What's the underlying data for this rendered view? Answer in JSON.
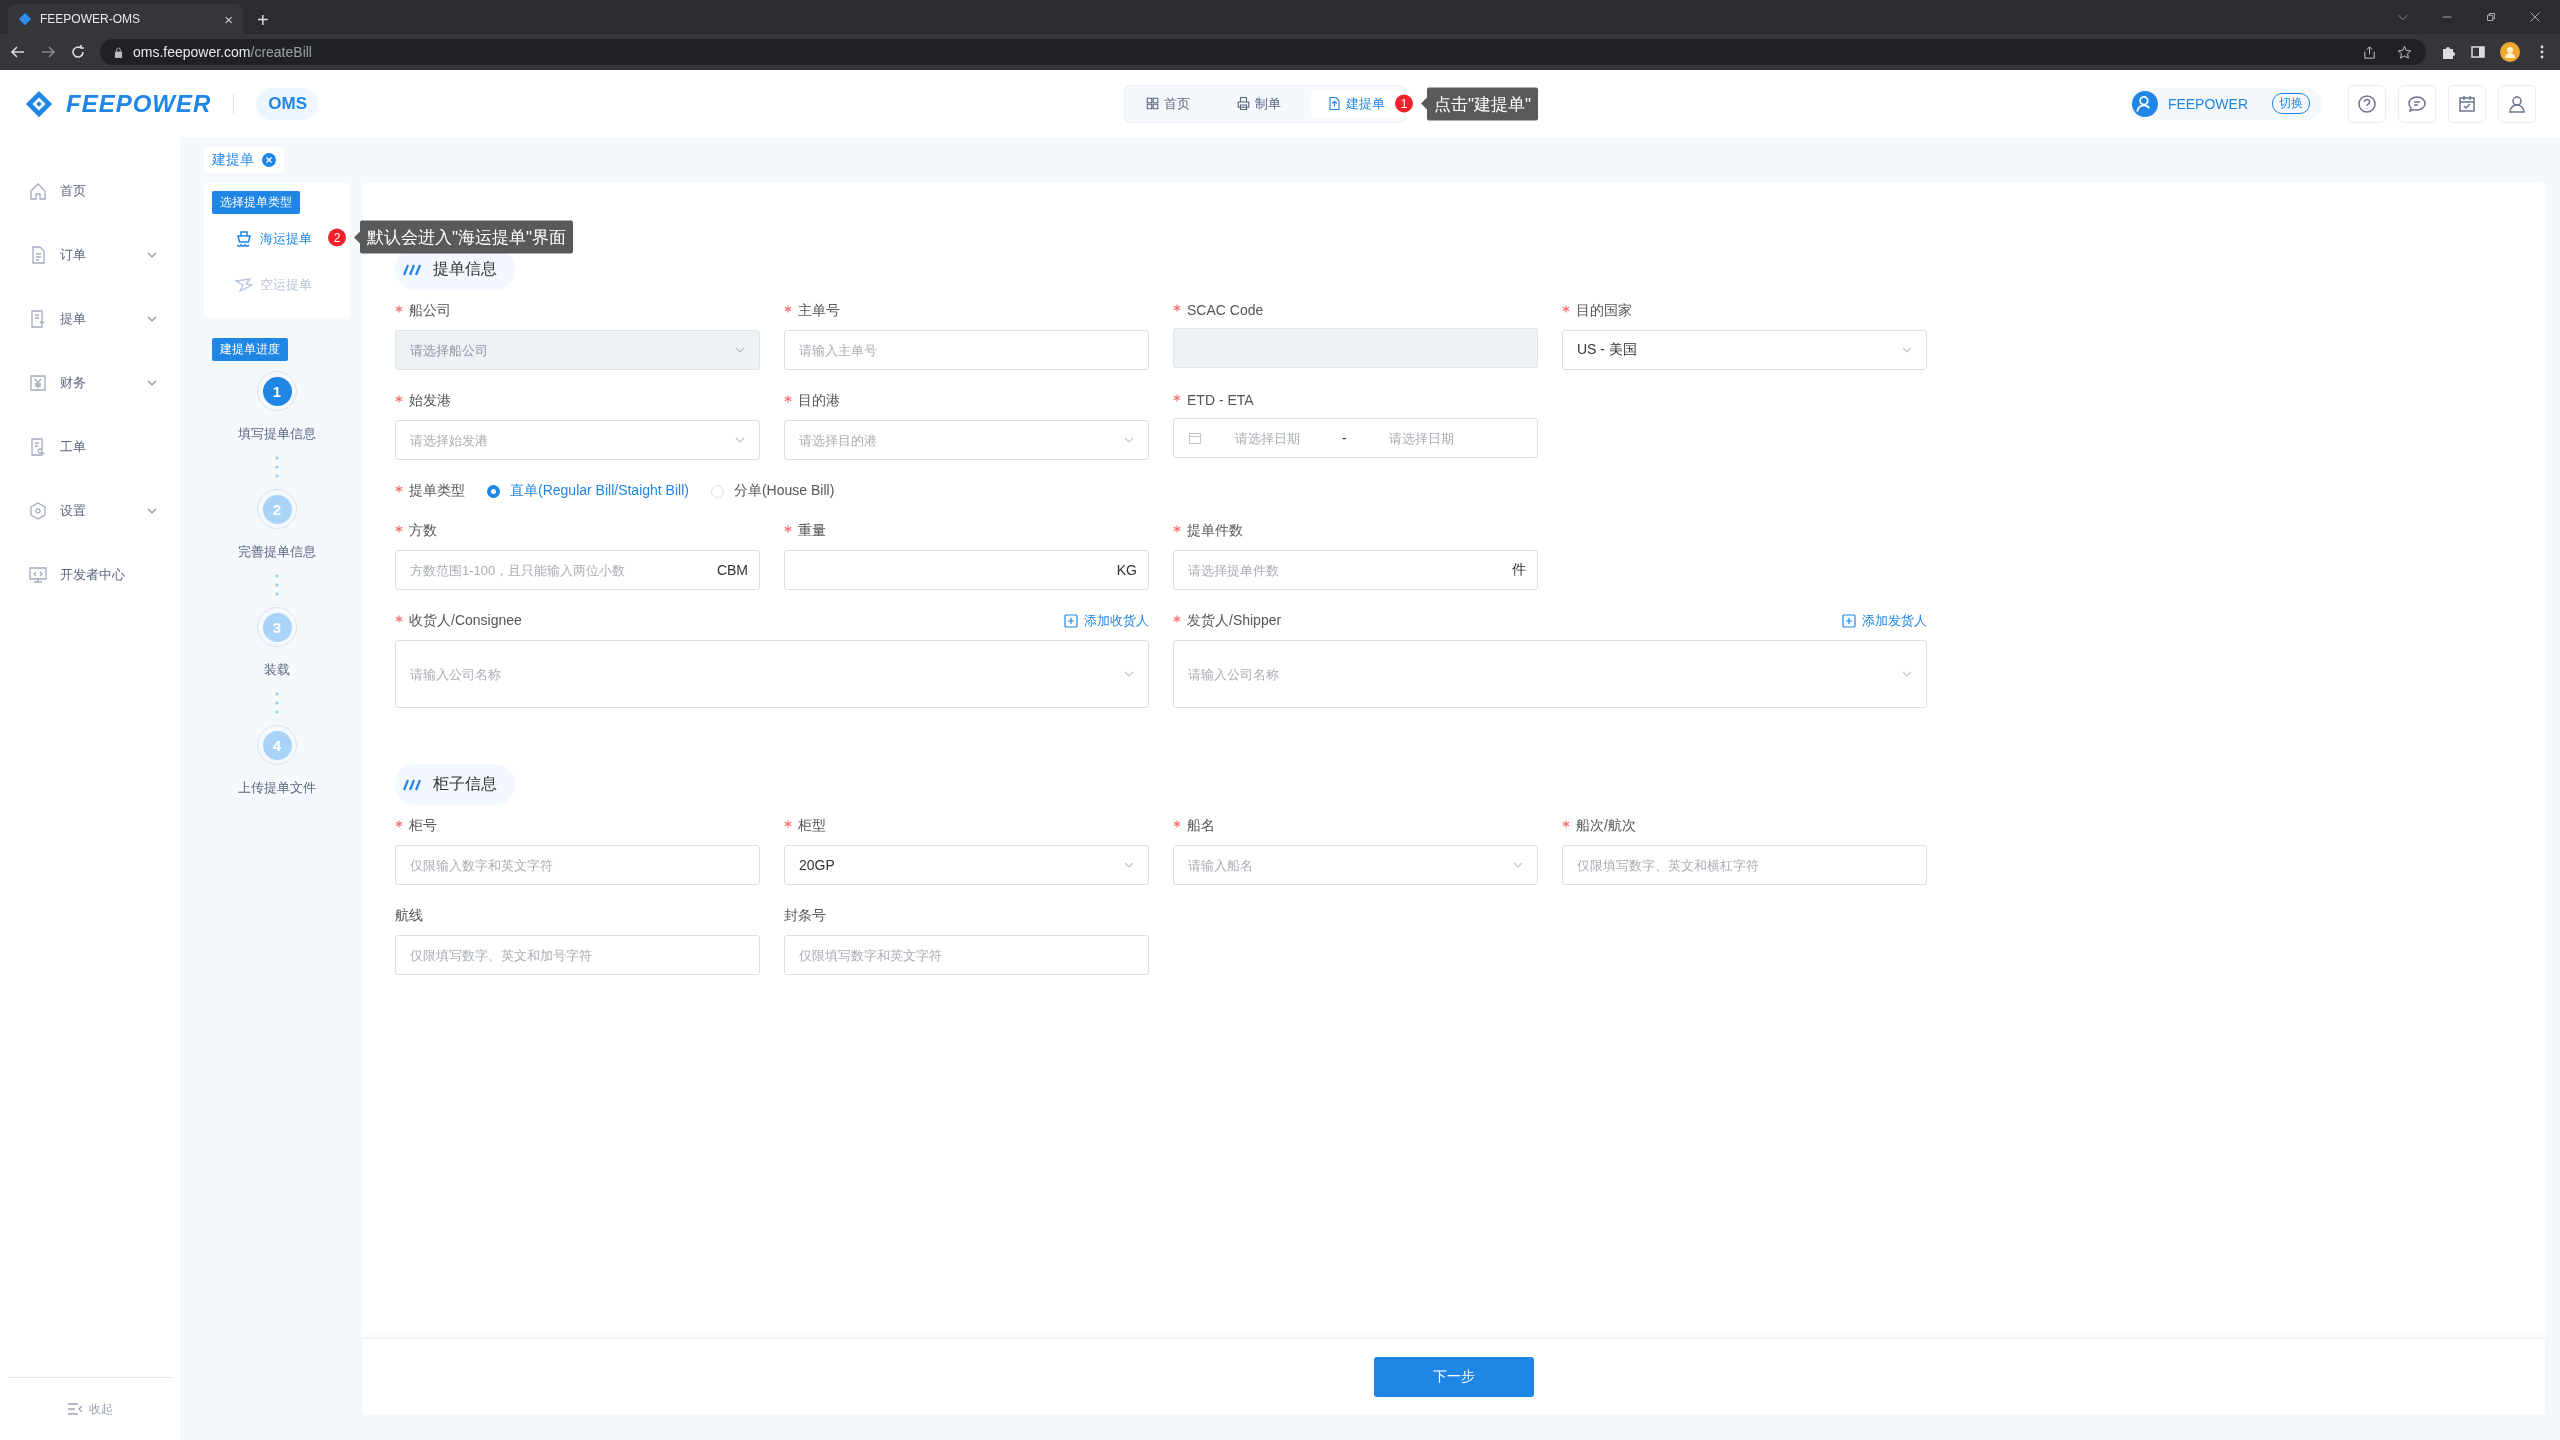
{
  "browser": {
    "tab_title": "FEEPOWER-OMS",
    "tab_close": "×",
    "new_tab": "+",
    "url_host": "oms.feepower.com",
    "url_path": "/createBill"
  },
  "header": {
    "logo": "FEEPOWER",
    "app": "OMS",
    "nav": [
      {
        "label": "首页",
        "selected": false
      },
      {
        "label": "制单",
        "selected": false
      },
      {
        "label": "建提单",
        "selected": true,
        "badge": "1"
      }
    ],
    "nav_tooltip": "点击\"建提单\"",
    "user": "FEEPOWER",
    "switch": "切换"
  },
  "sidebar": {
    "items": [
      {
        "label": "首页",
        "has_submenu": false
      },
      {
        "label": "订单",
        "has_submenu": true
      },
      {
        "label": "提单",
        "has_submenu": true
      },
      {
        "label": "财务",
        "has_submenu": true
      },
      {
        "label": "工单",
        "has_submenu": false
      },
      {
        "label": "设置",
        "has_submenu": true
      },
      {
        "label": "开发者中心",
        "has_submenu": false
      }
    ],
    "collapse": "收起"
  },
  "page_tabs": [
    {
      "label": "建提单",
      "selected": true
    }
  ],
  "bill_type": {
    "title": "选择提单类型",
    "tooltip": "默认会进入\"海运提单\"界面",
    "options": [
      {
        "label": "海运提单",
        "selected": true,
        "badge": "2"
      },
      {
        "label": "空运提单",
        "selected": false
      }
    ]
  },
  "progress": {
    "title": "建提单进度",
    "steps": [
      {
        "number": "1",
        "label": "填写提单信息",
        "selected": true
      },
      {
        "number": "2",
        "label": "完善提单信息",
        "selected": false
      },
      {
        "number": "3",
        "label": "装载",
        "selected": false
      },
      {
        "number": "4",
        "label": "上传提单文件",
        "selected": false
      }
    ]
  },
  "sections": [
    {
      "title": "提单信息",
      "rows": [
        [
          {
            "kind": "select",
            "label": "船公司",
            "required": true,
            "placeholder": "请选择船公司",
            "disabled": true
          },
          {
            "kind": "input",
            "label": "主单号",
            "required": true,
            "placeholder": "请输入主单号",
            "disabled": false
          },
          {
            "kind": "input",
            "label": "SCAC Code",
            "required": true,
            "disabled": true
          },
          {
            "kind": "select",
            "label": "目的国家",
            "required": true,
            "value": "US - 美国",
            "disabled": false
          }
        ],
        [
          {
            "kind": "select",
            "label": "始发港",
            "required": true,
            "placeholder": "请选择始发港",
            "disabled": false
          },
          {
            "kind": "select",
            "label": "目的港",
            "required": true,
            "placeholder": "请选择目的港",
            "disabled": false
          },
          {
            "kind": "daterange",
            "label": "ETD - ETA",
            "required": true,
            "start_placeholder": "请选择日期",
            "separator": "-",
            "end_placeholder": "请选择日期",
            "disabled": false
          }
        ],
        [
          {
            "kind": "radio",
            "label": "提单类型",
            "required": true,
            "options": [
              {
                "label": "直单(Regular Bill/Staight Bill)",
                "selected": true
              },
              {
                "label": "分单(House Bill)",
                "selected": false
              }
            ]
          }
        ],
        [
          {
            "kind": "input",
            "label": "方数",
            "required": true,
            "placeholder": "方数范围1-100，且只能输入两位小数",
            "suffix": "CBM",
            "disabled": false
          },
          {
            "kind": "input",
            "label": "重量",
            "required": true,
            "suffix": "KG",
            "disabled": false
          },
          {
            "kind": "input",
            "label": "提单件数",
            "required": true,
            "placeholder": "请选择提单件数",
            "suffix": "件",
            "disabled": false
          }
        ]
      ],
      "parties": [
        {
          "kind": "company",
          "label": "收货人/Consignee",
          "required": true,
          "placeholder": "请输入公司名称",
          "action": "添加收货人",
          "disabled": false
        },
        {
          "kind": "company",
          "label": "发货人/Shipper",
          "required": true,
          "placeholder": "请输入公司名称",
          "action": "添加发货人",
          "disabled": false
        }
      ]
    },
    {
      "title": "柜子信息",
      "rows": [
        [
          {
            "kind": "input",
            "label": "柜号",
            "required": true,
            "placeholder": "仅限输入数字和英文字符",
            "disabled": false
          },
          {
            "kind": "select",
            "label": "柜型",
            "required": true,
            "value": "20GP",
            "disabled": false
          },
          {
            "kind": "select",
            "label": "船名",
            "required": true,
            "placeholder": "请输入船名",
            "disabled": false
          },
          {
            "kind": "input",
            "label": "船次/航次",
            "required": true,
            "placeholder": "仅限填写数字、英文和横杠字符",
            "disabled": false
          }
        ],
        [
          {
            "kind": "input",
            "label": "航线",
            "required": false,
            "placeholder": "仅限填写数字、英文和加号字符",
            "disabled": false
          },
          {
            "kind": "input",
            "label": "封条号",
            "required": false,
            "placeholder": "仅限填写数字和英文字符",
            "disabled": false
          }
        ]
      ]
    }
  ],
  "next_button": "下一步"
}
